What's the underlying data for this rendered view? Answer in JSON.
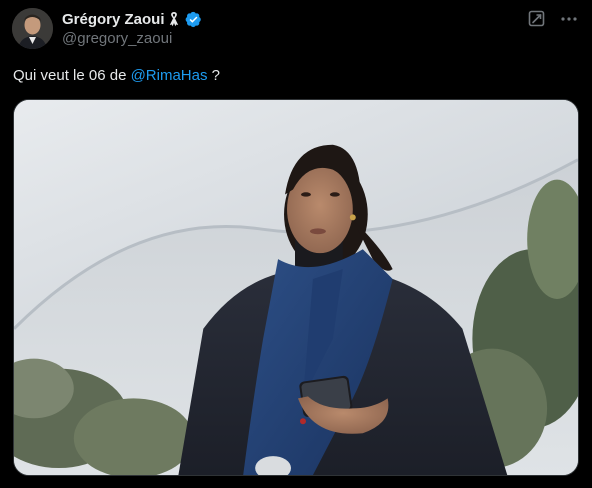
{
  "author": {
    "display_name": "Grégory Zaoui",
    "handle": "@gregory_zaoui",
    "avatar_icon": "avatar",
    "badges": [
      "ribbon-icon",
      "verified-icon"
    ]
  },
  "tweet": {
    "text_before": "Qui veut le 06 de ",
    "mention": "@RimaHas",
    "text_after": " ?"
  },
  "actions": {
    "grok_icon": "grok-icon",
    "more_icon": "more-icon"
  },
  "media": {
    "type": "photo",
    "icon": "tweet-photo"
  },
  "colors": {
    "background": "#000000",
    "text": "#e7e9ea",
    "secondary": "#71767b",
    "accent": "#1d9bf0"
  }
}
